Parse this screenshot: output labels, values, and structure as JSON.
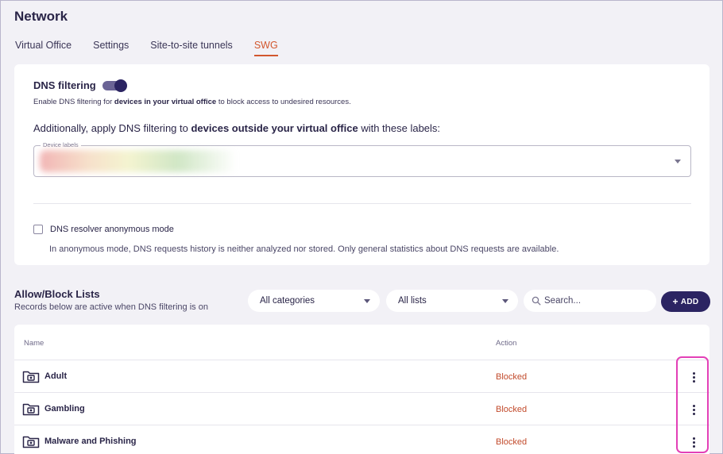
{
  "page": {
    "title": "Network"
  },
  "tabs": [
    {
      "label": "Virtual Office",
      "active": false
    },
    {
      "label": "Settings",
      "active": false
    },
    {
      "label": "Site-to-site tunnels",
      "active": false
    },
    {
      "label": "SWG",
      "active": true
    }
  ],
  "dns_filtering": {
    "title": "DNS filtering",
    "enabled": true,
    "description_pre": "Enable DNS filtering for ",
    "description_bold": "devices in your virtual office",
    "description_post": " to block access to undesired resources.",
    "extra_pre": "Additionally, apply DNS filtering to ",
    "extra_bold": "devices outside your virtual office",
    "extra_post": " with these labels:",
    "labels_field_legend": "Device labels",
    "anonymous_mode_label": "DNS resolver anonymous mode",
    "anonymous_mode_checked": false,
    "anonymous_mode_description": "In anonymous mode, DNS requests history is neither analyzed nor stored. Only general statistics about DNS requests are available."
  },
  "lists": {
    "title": "Allow/Block Lists",
    "subtitle": "Records below are active when DNS filtering is on",
    "category_filter": "All categories",
    "list_filter": "All lists",
    "search_placeholder": "Search...",
    "add_label": "ADD",
    "columns": {
      "name": "Name",
      "action": "Action"
    },
    "rows": [
      {
        "name": "Adult",
        "action": "Blocked"
      },
      {
        "name": "Gambling",
        "action": "Blocked"
      },
      {
        "name": "Malware and Phishing",
        "action": "Blocked"
      }
    ]
  },
  "colors": {
    "accent": "#d2572e",
    "primary": "#2b2462",
    "blocked": "#c24b2c",
    "highlight": "#e340b7"
  }
}
